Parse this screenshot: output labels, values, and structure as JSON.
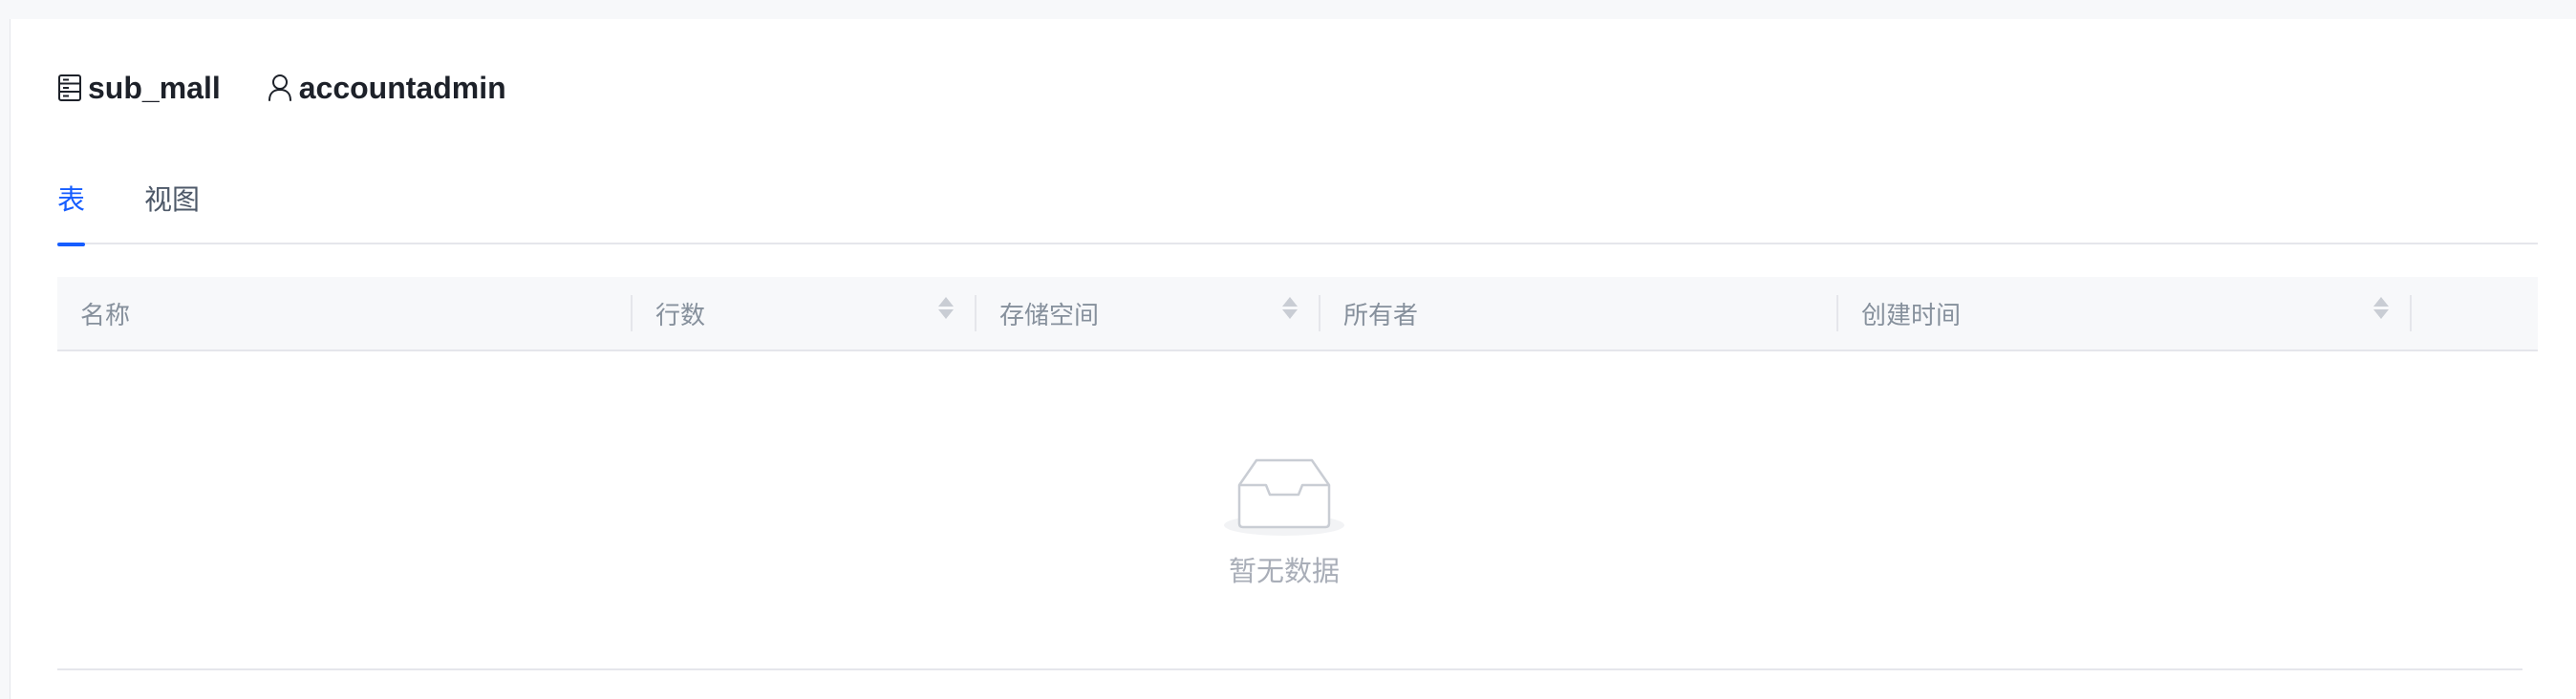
{
  "header": {
    "database": {
      "icon": "database-icon",
      "label": "sub_mall"
    },
    "owner": {
      "icon": "user-icon",
      "label": "accountadmin"
    }
  },
  "tabs": [
    {
      "label": "表",
      "active": true
    },
    {
      "label": "视图",
      "active": false
    }
  ],
  "table": {
    "columns": [
      {
        "label": "名称",
        "sortable": false
      },
      {
        "label": "行数",
        "sortable": true
      },
      {
        "label": "存储空间",
        "sortable": true
      },
      {
        "label": "所有者",
        "sortable": false
      },
      {
        "label": "创建时间",
        "sortable": true
      },
      {
        "label": "",
        "sortable": false
      }
    ],
    "rows": [],
    "empty_icon": "empty-inbox-icon",
    "empty_text": "暂无数据"
  },
  "colors": {
    "accent": "#165dff",
    "header_bg": "#f7f8fa",
    "border": "#e5e6eb",
    "muted_text": "#86909c"
  }
}
